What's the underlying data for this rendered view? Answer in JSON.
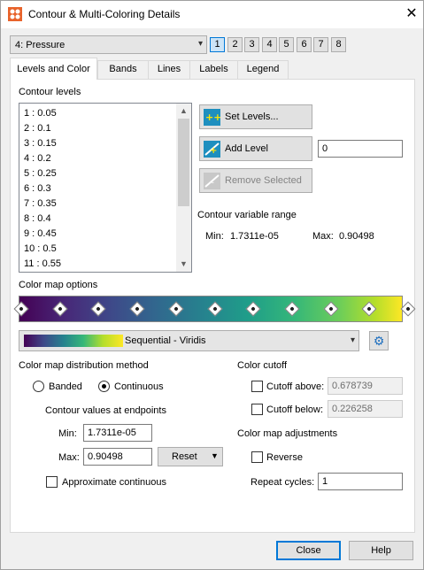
{
  "window": {
    "title": "Contour & Multi-Coloring Details",
    "close_glyph": "✕"
  },
  "variable_select": {
    "value": "4: Pressure",
    "arrow": "▾"
  },
  "group_buttons": [
    "1",
    "2",
    "3",
    "4",
    "5",
    "6",
    "7",
    "8"
  ],
  "active_group": "1",
  "tabs": [
    {
      "label": "Levels and Color",
      "active": true
    },
    {
      "label": "Bands",
      "active": false
    },
    {
      "label": "Lines",
      "active": false
    },
    {
      "label": "Labels",
      "active": false
    },
    {
      "label": "Legend",
      "active": false
    }
  ],
  "contour_levels": {
    "heading": "Contour levels",
    "items": [
      "1 : 0.05",
      "2 : 0.1",
      "3 : 0.15",
      "4 : 0.2",
      "5 : 0.25",
      "6 : 0.3",
      "7 : 0.35",
      "8 : 0.4",
      "9 : 0.45",
      "10 : 0.5",
      "11 : 0.55"
    ],
    "scroll_up": "▲",
    "scroll_down": "▼"
  },
  "level_actions": {
    "set_levels": "Set Levels...",
    "add_level": "Add Level",
    "add_level_value": "0",
    "remove_selected": "Remove Selected"
  },
  "variable_range": {
    "heading": "Contour variable range",
    "min_label": "Min:",
    "min_value": "1.7311e-05",
    "max_label": "Max:",
    "max_value": "0.90498"
  },
  "color_map": {
    "heading": "Color map options",
    "selected": "Sequential - Viridis",
    "arrow": "▾",
    "gear_icon": "⚙",
    "colors": [
      "#440154",
      "#482878",
      "#3e4989",
      "#31688e",
      "#26828e",
      "#1f9e89",
      "#35b779",
      "#6ece58",
      "#b5de2b",
      "#fde725"
    ]
  },
  "distribution": {
    "heading": "Color map distribution method",
    "banded": "Banded",
    "continuous": "Continuous",
    "selected": "continuous",
    "endpoints_heading": "Contour values at endpoints",
    "min_label": "Min:",
    "min_value": "1.7311e-05",
    "max_label": "Max:",
    "max_value": "0.90498",
    "reset_label": "Reset",
    "reset_arrow": "▼",
    "approx_label": "Approximate continuous",
    "approx_checked": false
  },
  "color_cutoff": {
    "heading": "Color cutoff",
    "above_label": "Cutoff above:",
    "above_value": "0.678739",
    "above_checked": false,
    "below_label": "Cutoff below:",
    "below_value": "0.226258",
    "below_checked": false
  },
  "adjustments": {
    "heading": "Color map adjustments",
    "reverse_label": "Reverse",
    "reverse_checked": false,
    "repeat_label": "Repeat cycles:",
    "repeat_value": "1"
  },
  "footer": {
    "close": "Close",
    "help": "Help"
  }
}
